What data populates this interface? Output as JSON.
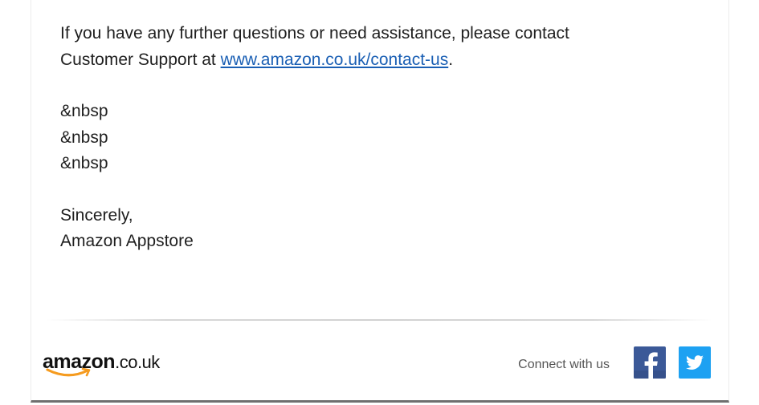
{
  "email": {
    "body_line1": "If you have any further questions or need assistance, please contact",
    "body_line2_prefix": "Customer Support at ",
    "support_link": "www.amazon.co.uk/contact-us",
    "body_line2_suffix": ".",
    "nbsp_lines": [
      "&nbsp",
      "&nbsp",
      "&nbsp"
    ],
    "closing": "Sincerely,",
    "signature": "Amazon Appstore"
  },
  "footer": {
    "logo_brand": "amazon",
    "logo_tld": ".co.uk",
    "connect_label": "Connect with us",
    "social_icons": [
      "facebook-icon",
      "twitter-icon"
    ]
  },
  "colors": {
    "link": "#1a5fb4",
    "facebook": "#3b5998",
    "twitter": "#1da1f2",
    "amazon_smile": "#f59b1f",
    "bottom_border": "#6f6f6f"
  }
}
